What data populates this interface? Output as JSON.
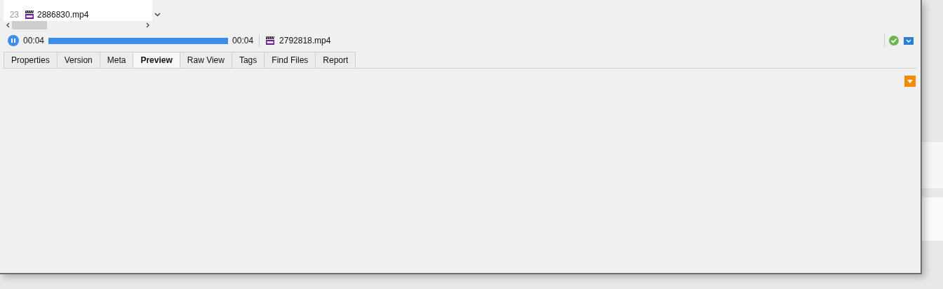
{
  "file_list": {
    "rows": [
      {
        "number": "23",
        "name": "2886830.mp4"
      }
    ]
  },
  "player": {
    "playing": true,
    "elapsed": "00:04",
    "level": 1,
    "total": "00:04",
    "file_name": "2792818.mp4"
  },
  "tabs": [
    {
      "label": "Properties",
      "selected": false
    },
    {
      "label": "Version",
      "selected": false
    },
    {
      "label": "Meta",
      "selected": false
    },
    {
      "label": "Preview",
      "selected": true
    },
    {
      "label": "Raw View",
      "selected": false
    },
    {
      "label": "Tags",
      "selected": false
    },
    {
      "label": "Find Files",
      "selected": false
    },
    {
      "label": "Report",
      "selected": false
    }
  ]
}
